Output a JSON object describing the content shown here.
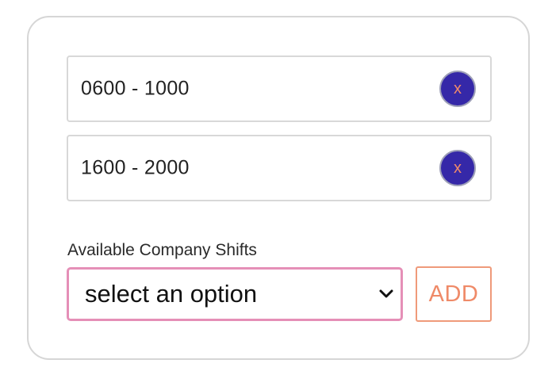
{
  "shifts": [
    {
      "label": "0600 - 1000",
      "remove_label": "x"
    },
    {
      "label": "1600 - 2000",
      "remove_label": "x"
    }
  ],
  "available_shifts": {
    "label": "Available Company Shifts",
    "selected_value": "select an option",
    "add_label": "ADD"
  },
  "colors": {
    "remove_button_bg": "#3528a8",
    "remove_button_text": "#f08a6a",
    "select_border": "#e58fb7",
    "add_button_accent": "#ef8a68"
  },
  "icons": {
    "select_chevron": "chevron-down-icon"
  }
}
